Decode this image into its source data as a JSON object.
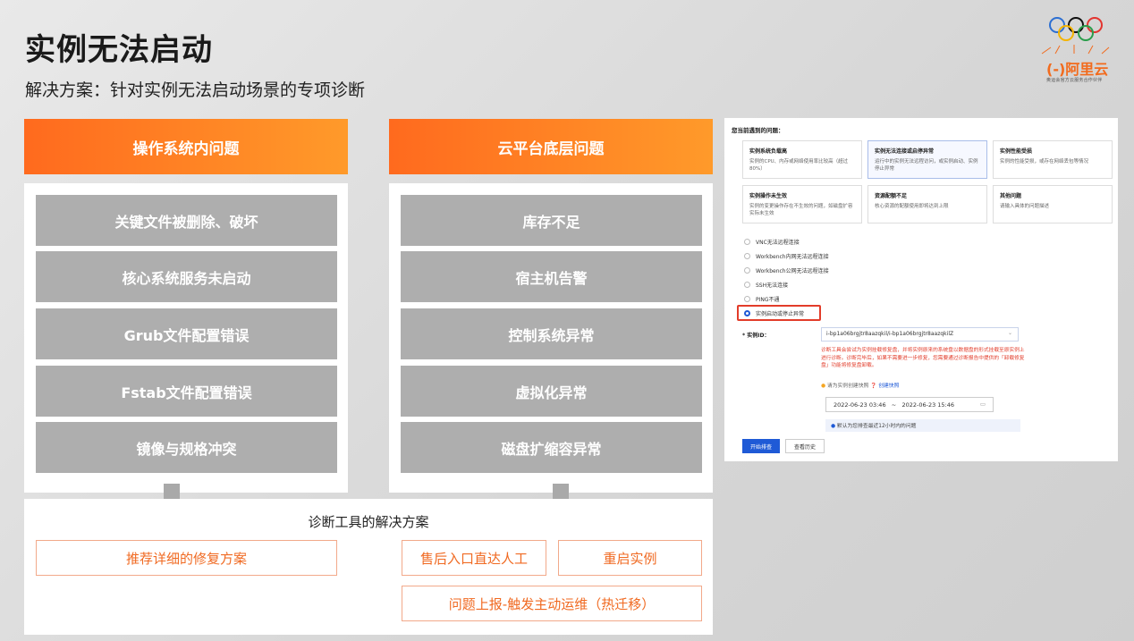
{
  "slide": {
    "title": "实例无法启动",
    "subtitle": "解决方案：针对实例无法启动场景的专项诊断"
  },
  "logo": {
    "brand": "阿里云",
    "tagline": "奥运会官方云服务合作伙伴"
  },
  "columns": [
    {
      "header": "操作系统内问题",
      "items": [
        "关键文件被删除、破坏",
        "核心系统服务未启动",
        "Grub文件配置错误",
        "Fstab文件配置错误",
        "镜像与规格冲突"
      ]
    },
    {
      "header": "云平台底层问题",
      "items": [
        "库存不足",
        "宿主机告警",
        "控制系统异常",
        "虚拟化异常",
        "磁盘扩缩容异常"
      ]
    }
  ],
  "solutions": {
    "title": "诊断工具的解决方案",
    "buttons": [
      "推荐详细的修复方案",
      "售后入口直达人工",
      "重启实例",
      "问题上报-触发主动运维（热迁移）"
    ]
  },
  "console": {
    "heading": "您当前遇到的问题：",
    "cards": [
      {
        "title": "实例系统负载高",
        "desc": "实例的CPU、内存或网络使用率比较高（超过80%）"
      },
      {
        "title": "实例无法连接或启停异常",
        "desc": "运行中的实例无法远程访问，或实例启动、实例停止异常"
      },
      {
        "title": "实例性能受损",
        "desc": "实例的性能受损，或存在网络丢包等情况"
      },
      {
        "title": "实例操作未生效",
        "desc": "实例的变更操作存在不生效的问题，如磁盘扩容实际未生效"
      },
      {
        "title": "资源配额不足",
        "desc": "核心资源的配额使用即将达到上限"
      },
      {
        "title": "其他问题",
        "desc": "请输入具体的问题描述"
      }
    ],
    "radio_options": [
      "VNC无法远程连接",
      "Workbench内网无法远程连接",
      "Workbench公网无法远程连接",
      "SSH无法连接",
      "PING不通",
      "实例启动或停止异常"
    ],
    "selected_radio": "实例启动或停止异常",
    "instance_label": "* 实例ID：",
    "instance_value": "i-bp1a06brgjtr8aazqkil/i-bp1a06brgjtr8aazqkilZ",
    "warning": "诊断工具会尝试为实例挂载修复盘，并将实例原来的系统盘以数据盘的形式挂载至原实例上进行诊断。诊断完毕后，如果不需要进一步修复，您需要通过诊断报告中提供的「卸载修复盘」功能将修复盘卸载。",
    "snapshot_hint": "请为实例创建快照",
    "snapshot_link": "创建快照",
    "date_start": "2022-06-23 03:46",
    "date_sep": "~",
    "date_end": "2022-06-23 15:46",
    "info": "默认为您排查最近12小时内的问题",
    "btn_start": "开始排查",
    "btn_history": "查看历史"
  }
}
